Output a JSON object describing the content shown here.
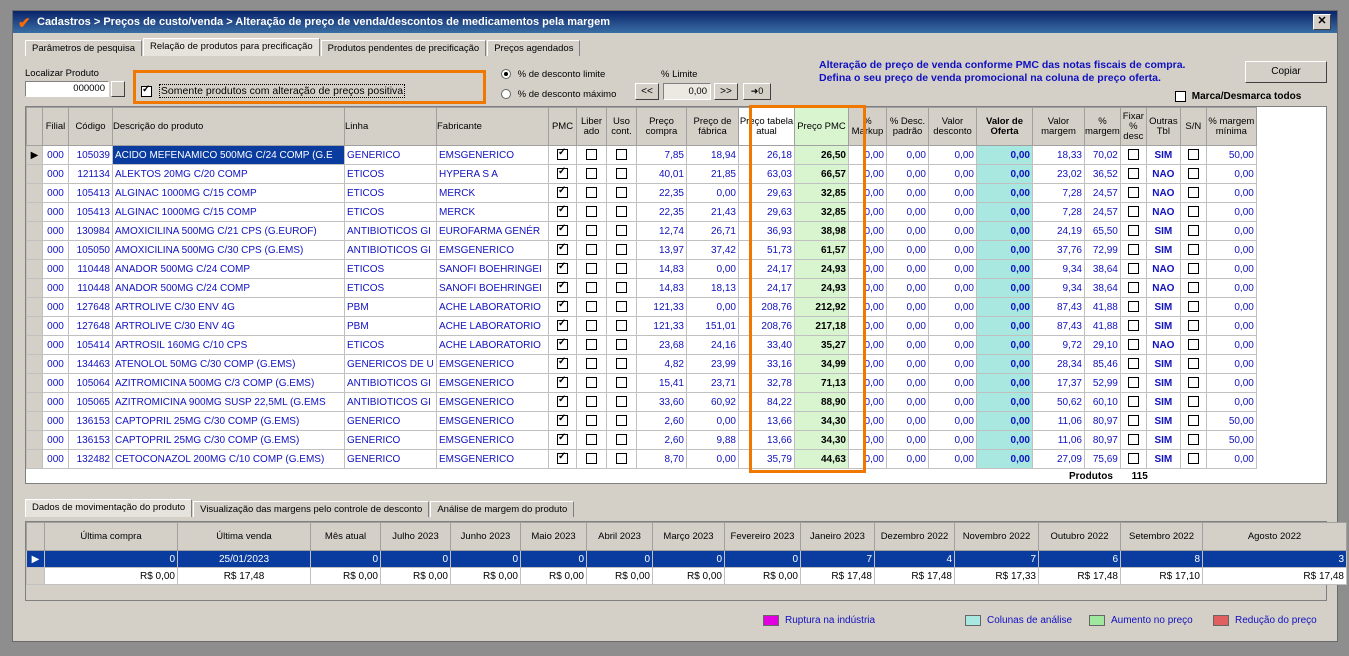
{
  "window": {
    "title": "Cadastros > Preços de custo/venda > Alteração de preço de venda/descontos de medicamentos pela margem",
    "close": "✕"
  },
  "tabs": [
    "Parâmetros de pesquisa",
    "Relação de produtos para precificação",
    "Produtos pendentes de precificação",
    "Preços agendados"
  ],
  "filters": {
    "localizar_label": "Localizar Produto",
    "localizar_value": "000000",
    "somente_label": "Somente produtos com alteração de preços positiva",
    "radio1": "% de desconto limite",
    "radio2": "% de desconto máximo",
    "limite_label": "% Limite",
    "limite_value": "0,00",
    "btn_prev": "<<",
    "btn_next": ">>",
    "btn_apply": "➜0",
    "info_line1": "Alteração de preço de venda conforme PMC das notas fiscais de compra.",
    "info_line2": "Defina o seu preço de venda promocional na coluna de preço oferta.",
    "copiar": "Copiar",
    "marca_label": "Marca/Desmarca todos"
  },
  "grid": {
    "headers": [
      "Filial",
      "Código",
      "Descrição do produto",
      "Linha",
      "Fabricante",
      "PMC",
      "Liber ado",
      "Uso cont.",
      "Preço compra",
      "Preço de fábrica",
      "Preço tabela atual",
      "Preço PMC",
      "% Markup",
      "% Desc. padrão",
      "Valor desconto",
      "Valor de Oferta",
      "Valor margem",
      "% margem",
      "Fixar % desc",
      "Outras Tbl",
      "S/N",
      "% margem mínima"
    ],
    "rows": [
      [
        "000",
        "105039",
        "ACIDO MEFENAMICO 500MG C/24 COMP (G.E",
        "GENERICO",
        "EMSGENERICO",
        "26,18",
        "26,50",
        "7,85",
        "18,94",
        "0,00",
        "0,00",
        "0,00",
        "0,00",
        "18,33",
        "70,02",
        "SIM",
        "50,00",
        true
      ],
      [
        "000",
        "121134",
        "ALEKTOS 20MG C/20 COMP",
        "ETICOS",
        "HYPERA S A",
        "63,03",
        "66,57",
        "40,01",
        "21,85",
        "0,00",
        "0,00",
        "0,00",
        "0,00",
        "23,02",
        "36,52",
        "NAO",
        "0,00",
        false
      ],
      [
        "000",
        "105413",
        "ALGINAC 1000MG C/15 COMP",
        "ETICOS",
        "MERCK",
        "29,63",
        "32,85",
        "22,35",
        "0,00",
        "0,00",
        "0,00",
        "0,00",
        "0,00",
        "7,28",
        "24,57",
        "NAO",
        "0,00",
        false
      ],
      [
        "000",
        "105413",
        "ALGINAC 1000MG C/15 COMP",
        "ETICOS",
        "MERCK",
        "29,63",
        "32,85",
        "22,35",
        "21,43",
        "0,00",
        "0,00",
        "0,00",
        "0,00",
        "7,28",
        "24,57",
        "NAO",
        "0,00",
        false
      ],
      [
        "000",
        "130984",
        "AMOXICILINA 500MG C/21 CPS (G.EUROF)",
        "ANTIBIOTICOS GI",
        "EUROFARMA GENÉR",
        "36,93",
        "38,98",
        "12,74",
        "26,71",
        "0,00",
        "0,00",
        "0,00",
        "0,00",
        "24,19",
        "65,50",
        "SIM",
        "0,00",
        false
      ],
      [
        "000",
        "105050",
        "AMOXICILINA 500MG C/30 CPS (G.EMS)",
        "ANTIBIOTICOS GI",
        "EMSGENERICO",
        "51,73",
        "61,57",
        "13,97",
        "37,42",
        "0,00",
        "0,00",
        "0,00",
        "0,00",
        "37,76",
        "72,99",
        "SIM",
        "0,00",
        false
      ],
      [
        "000",
        "110448",
        "ANADOR 500MG C/24 COMP",
        "ETICOS",
        "SANOFI BOEHRINGEI",
        "24,17",
        "24,93",
        "14,83",
        "0,00",
        "0,00",
        "0,00",
        "0,00",
        "0,00",
        "9,34",
        "38,64",
        "NAO",
        "0,00",
        false
      ],
      [
        "000",
        "110448",
        "ANADOR 500MG C/24 COMP",
        "ETICOS",
        "SANOFI BOEHRINGEI",
        "24,17",
        "24,93",
        "14,83",
        "18,13",
        "0,00",
        "0,00",
        "0,00",
        "0,00",
        "9,34",
        "38,64",
        "NAO",
        "0,00",
        false
      ],
      [
        "000",
        "127648",
        "ARTROLIVE C/30 ENV 4G",
        "PBM",
        "ACHE LABORATORIO",
        "208,76",
        "212,92",
        "121,33",
        "0,00",
        "0,00",
        "0,00",
        "0,00",
        "0,00",
        "87,43",
        "41,88",
        "SIM",
        "0,00",
        false
      ],
      [
        "000",
        "127648",
        "ARTROLIVE C/30 ENV 4G",
        "PBM",
        "ACHE LABORATORIO",
        "208,76",
        "217,18",
        "121,33",
        "151,01",
        "0,00",
        "0,00",
        "0,00",
        "0,00",
        "87,43",
        "41,88",
        "SIM",
        "0,00",
        false
      ],
      [
        "000",
        "105414",
        "ARTROSIL 160MG C/10 CPS",
        "ETICOS",
        "ACHE LABORATORIO",
        "33,40",
        "35,27",
        "23,68",
        "24,16",
        "0,00",
        "0,00",
        "0,00",
        "0,00",
        "9,72",
        "29,10",
        "NAO",
        "0,00",
        false
      ],
      [
        "000",
        "134463",
        "ATENOLOL 50MG C/30 COMP (G.EMS)",
        "GENERICOS DE U",
        "EMSGENERICO",
        "33,16",
        "34,99",
        "4,82",
        "23,99",
        "0,00",
        "0,00",
        "0,00",
        "0,00",
        "28,34",
        "85,46",
        "SIM",
        "0,00",
        false
      ],
      [
        "000",
        "105064",
        "AZITROMICINA 500MG C/3 COMP (G.EMS)",
        "ANTIBIOTICOS GI",
        "EMSGENERICO",
        "32,78",
        "71,13",
        "15,41",
        "23,71",
        "0,00",
        "0,00",
        "0,00",
        "0,00",
        "17,37",
        "52,99",
        "SIM",
        "0,00",
        false
      ],
      [
        "000",
        "105065",
        "AZITROMICINA 900MG SUSP 22,5ML (G.EMS",
        "ANTIBIOTICOS GI",
        "EMSGENERICO",
        "84,22",
        "88,90",
        "33,60",
        "60,92",
        "0,00",
        "0,00",
        "0,00",
        "0,00",
        "50,62",
        "60,10",
        "SIM",
        "0,00",
        false
      ],
      [
        "000",
        "136153",
        "CAPTOPRIL 25MG C/30 COMP (G.EMS)",
        "GENERICO",
        "EMSGENERICO",
        "13,66",
        "34,30",
        "2,60",
        "0,00",
        "0,00",
        "0,00",
        "0,00",
        "0,00",
        "11,06",
        "80,97",
        "SIM",
        "50,00",
        false
      ],
      [
        "000",
        "136153",
        "CAPTOPRIL 25MG C/30 COMP (G.EMS)",
        "GENERICO",
        "EMSGENERICO",
        "13,66",
        "34,30",
        "2,60",
        "9,88",
        "0,00",
        "0,00",
        "0,00",
        "0,00",
        "11,06",
        "80,97",
        "SIM",
        "50,00",
        false
      ],
      [
        "000",
        "132482",
        "CETOCONAZOL 200MG C/10 COMP (G.EMS)",
        "GENERICO",
        "EMSGENERICO",
        "35,79",
        "44,63",
        "8,70",
        "0,00",
        "0,00",
        "0,00",
        "0,00",
        "0,00",
        "27,09",
        "75,69",
        "SIM",
        "0,00",
        false
      ]
    ],
    "footer_label": "Produtos",
    "footer_count": "115"
  },
  "bottom_tabs": [
    "Dados de movimentação do produto",
    "Visualização das margens pelo controle de desconto",
    "Análise de margem do produto"
  ],
  "bottom_grid": {
    "headers": [
      "Última compra",
      "Última venda",
      "Mês atual",
      "Julho 2023",
      "Junho 2023",
      "Maio 2023",
      "Abril 2023",
      "Março 2023",
      "Fevereiro 2023",
      "Janeiro 2023",
      "Dezembro 2022",
      "Novembro 2022",
      "Outubro 2022",
      "Setembro 2022",
      "Agosto 2022"
    ],
    "row1": [
      "0",
      "25/01/2023",
      "0",
      "0",
      "0",
      "0",
      "0",
      "0",
      "0",
      "7",
      "4",
      "7",
      "6",
      "8",
      "3"
    ],
    "row2": [
      "R$ 0,00",
      "R$ 17,48",
      "R$ 0,00",
      "R$ 0,00",
      "R$ 0,00",
      "R$ 0,00",
      "R$ 0,00",
      "R$ 0,00",
      "R$ 0,00",
      "R$ 17,48",
      "R$ 17,48",
      "R$ 17,33",
      "R$ 17,48",
      "R$ 17,10",
      "R$ 17,48"
    ]
  },
  "legend": {
    "ruptura": "Ruptura na indústria",
    "analise": "Colunas de análise",
    "aumento": "Aumento no preço",
    "reducao": "Redução do preço"
  },
  "colors": {
    "ruptura": "#e000e0",
    "analise": "#a8e8e0",
    "aumento": "#a0e8a0",
    "reducao": "#e06060",
    "highlight": "#f07800"
  }
}
